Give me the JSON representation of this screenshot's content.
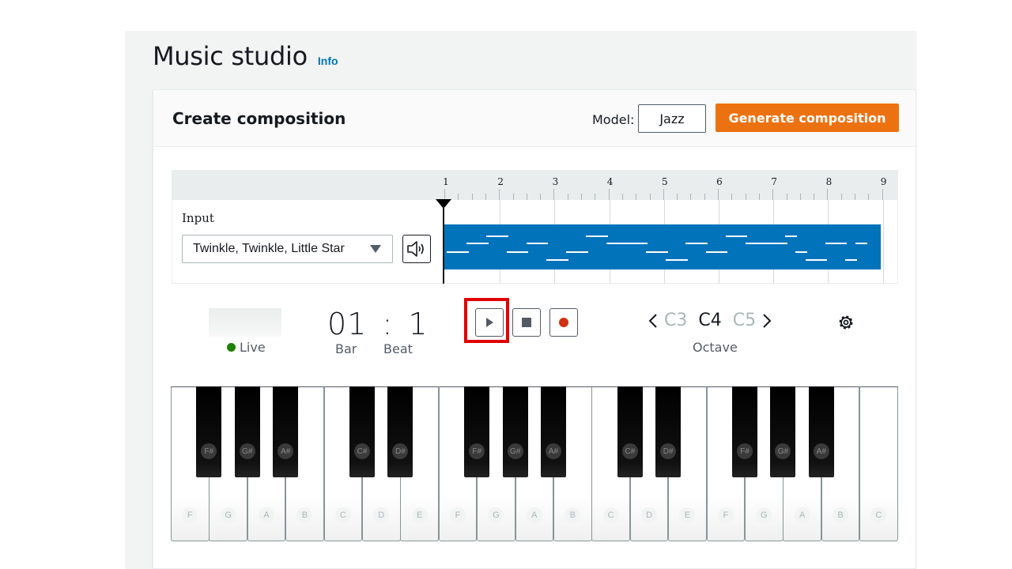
{
  "page": {
    "title": "Music studio",
    "info_link": "Info"
  },
  "composition": {
    "title": "Create composition",
    "model_label": "Model:",
    "model_value": "Jazz",
    "generate_button": "Generate composition"
  },
  "timeline": {
    "bar_numbers": [
      "1",
      "2",
      "3",
      "4",
      "5",
      "6",
      "7",
      "8",
      "9"
    ],
    "input_label": "Input",
    "input_selected": "Twinkle, Twinkle, Little Star"
  },
  "transport": {
    "live_label": "Live",
    "counter": {
      "bar": "01",
      "separator": ":",
      "beat": "1"
    },
    "bar_label": "Bar",
    "beat_label": "Beat",
    "buttons": [
      "play",
      "stop",
      "record"
    ]
  },
  "octave": {
    "prev": "C3",
    "current": "C4",
    "next": "C5",
    "label": "Octave"
  },
  "piano": {
    "white_keys": [
      "F",
      "G",
      "A",
      "B",
      "C",
      "D",
      "E",
      "F",
      "G",
      "A",
      "B",
      "C",
      "D",
      "E",
      "F",
      "G",
      "A",
      "B",
      "C"
    ],
    "black_keys": [
      "F#",
      "G#",
      "A#",
      "C#",
      "D#",
      "F#",
      "G#",
      "A#",
      "C#",
      "D#",
      "F#",
      "G#",
      "A#"
    ]
  },
  "colors": {
    "accent_orange": "#ec7211",
    "clip_blue": "#0073bb",
    "live_green": "#1d8102",
    "record_red": "#d13212",
    "highlight_red": "#e00000",
    "info_blue": "#0073bb"
  }
}
